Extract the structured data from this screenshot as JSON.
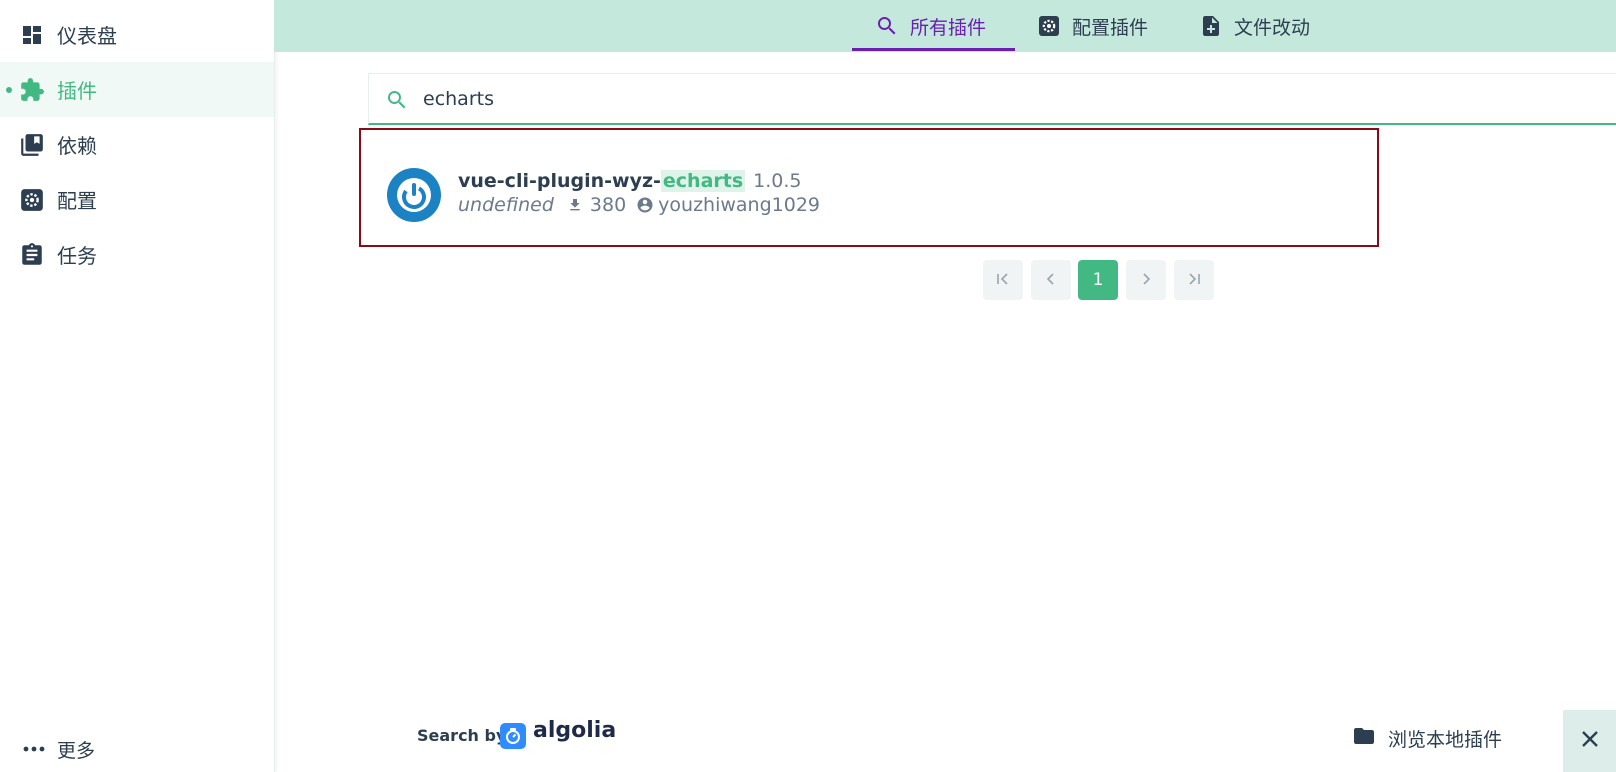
{
  "sidebar": {
    "items": [
      {
        "label": "仪表盘",
        "icon": "dashboard-icon"
      },
      {
        "label": "插件",
        "icon": "puzzle-icon",
        "active": true
      },
      {
        "label": "依赖",
        "icon": "library-books-icon"
      },
      {
        "label": "配置",
        "icon": "gear-icon"
      },
      {
        "label": "任务",
        "icon": "clipboard-icon"
      }
    ],
    "more_label": "更多"
  },
  "tabs": [
    {
      "label": "所有插件",
      "icon": "search-icon",
      "active": true
    },
    {
      "label": "配置插件",
      "icon": "gear-icon"
    },
    {
      "label": "文件改动",
      "icon": "file-plus-icon"
    }
  ],
  "search": {
    "value": "echarts"
  },
  "results": [
    {
      "name_prefix": "vue-cli-plugin-wyz-",
      "name_highlight": "echarts",
      "version": "1.0.5",
      "description": "undefined",
      "downloads": "380",
      "author": "youzhiwang1029"
    }
  ],
  "pagination": {
    "current": "1"
  },
  "footer": {
    "search_by": "Search by",
    "brand": "algolia",
    "browse_label": "浏览本地插件"
  },
  "colors": {
    "accent": "#42b983",
    "tab_active": "#6a1fb3",
    "topbar": "#c4e9dc",
    "highlight_border": "#8b0a1a"
  }
}
